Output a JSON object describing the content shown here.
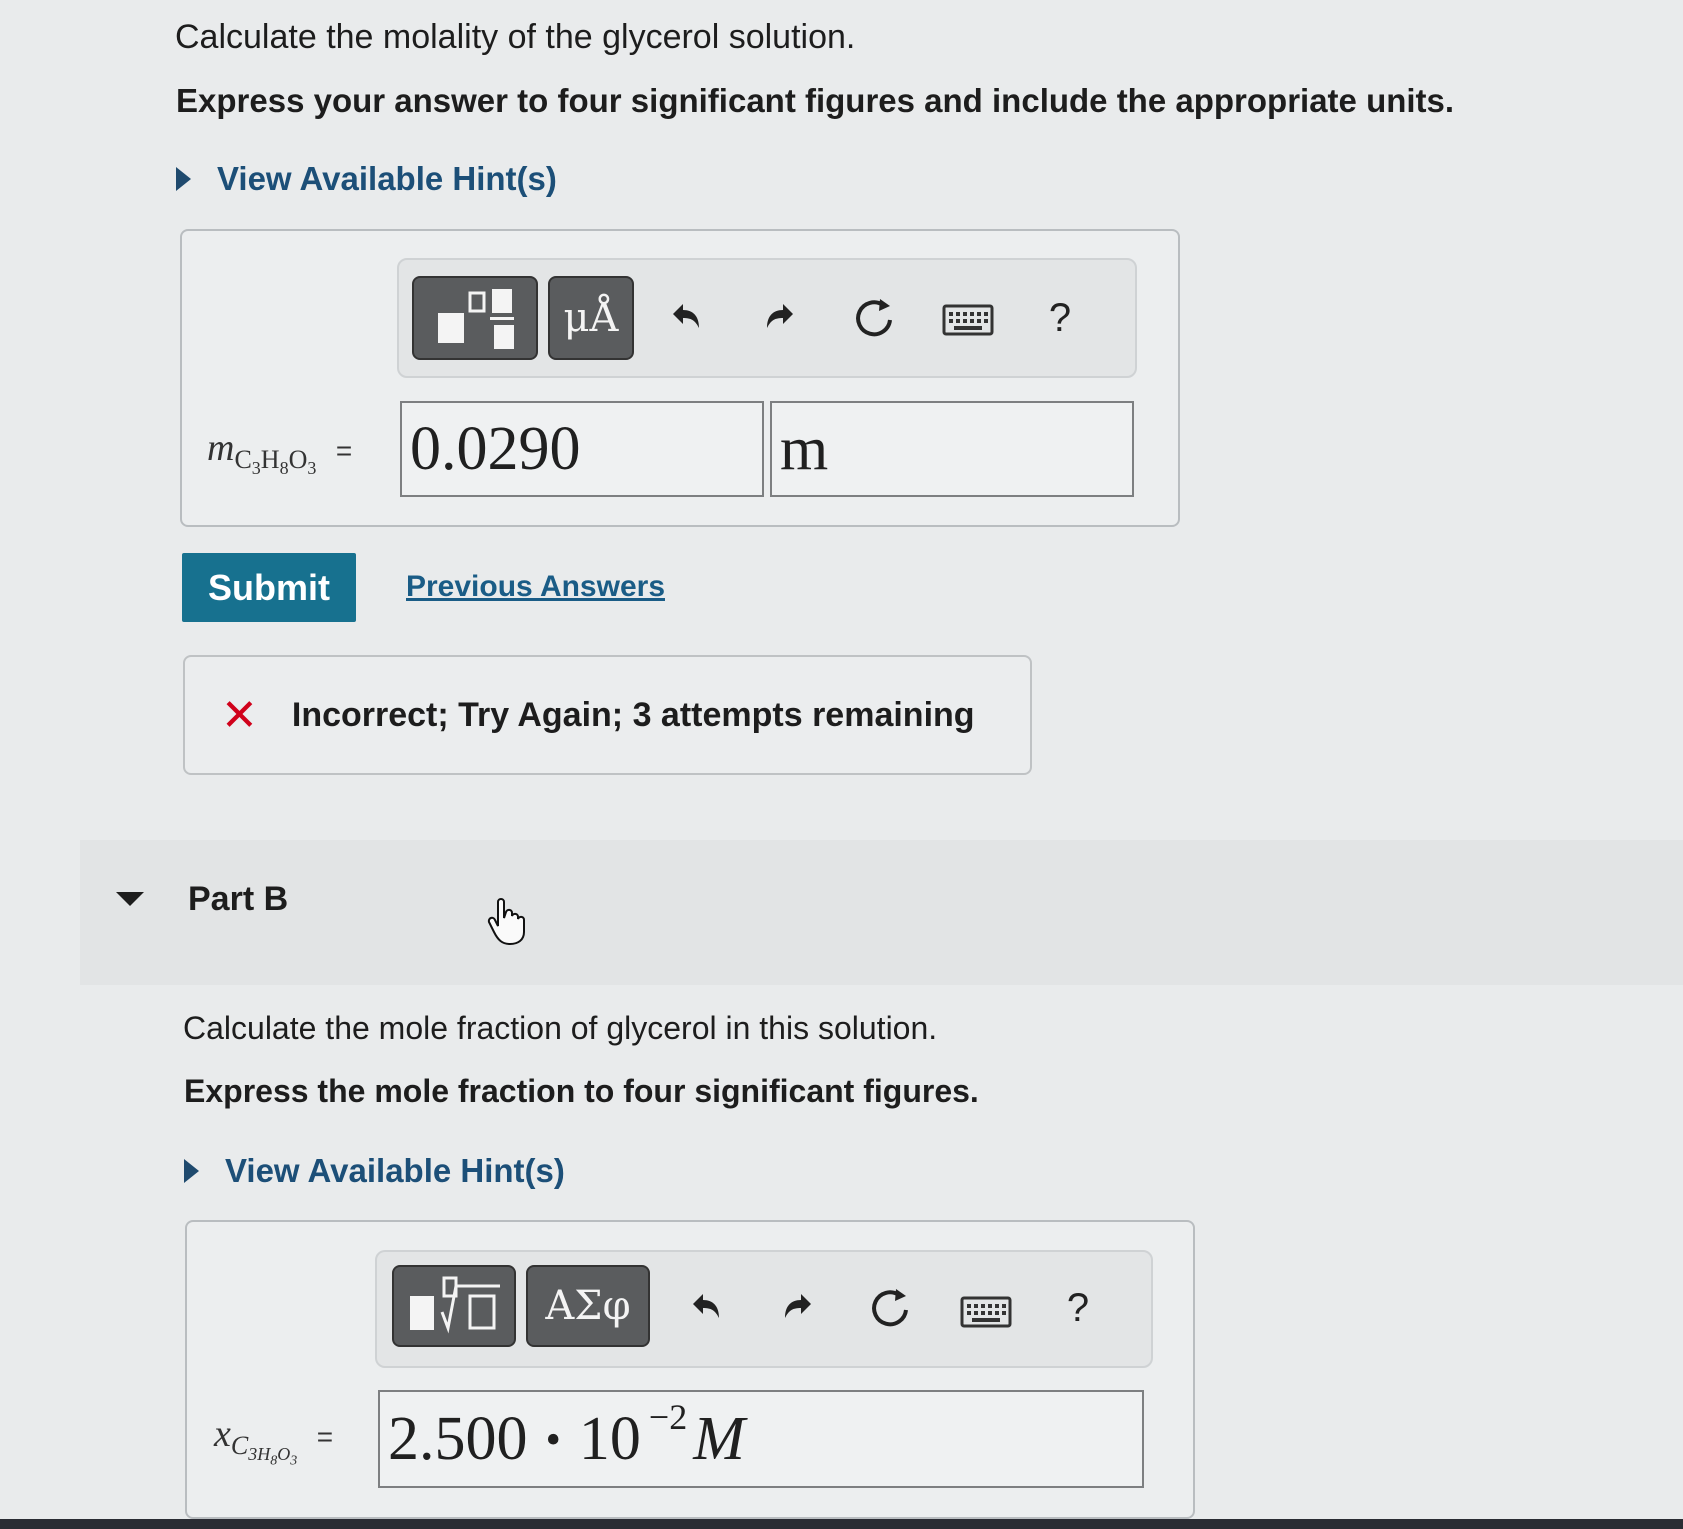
{
  "partA": {
    "question": "Calculate the molality of the glycerol solution.",
    "instruction": "Express your answer to four significant figures and include the appropriate units.",
    "hint_label": "View Available Hint(s)",
    "toolbar": {
      "templates_icon": "templates-icon",
      "units_label": "μÅ",
      "undo_icon": "undo-icon",
      "redo_icon": "redo-icon",
      "reset_icon": "reset-icon",
      "keyboard_icon": "keyboard-icon",
      "help_label": "?"
    },
    "variable": {
      "symbol": "m",
      "subscript_html": "C<sub>3</sub>H<sub>8</sub>O<sub>3</sub>",
      "equals": "="
    },
    "answer_value": "0.0290",
    "answer_unit": "m",
    "submit_label": "Submit",
    "previous_answers_label": "Previous Answers",
    "feedback": {
      "icon": "✕",
      "text": "Incorrect; Try Again; 3 attempts remaining",
      "icon_color": "#d0021b"
    }
  },
  "partB": {
    "title": "Part B",
    "question": "Calculate the mole fraction of glycerol in this solution.",
    "instruction": "Express the mole fraction to four significant figures.",
    "hint_label": "View Available Hint(s)",
    "toolbar": {
      "templates_icon": "templates-icon",
      "greek_label": "ΑΣφ",
      "undo_icon": "undo-icon",
      "redo_icon": "redo-icon",
      "reset_icon": "reset-icon",
      "keyboard_icon": "keyboard-icon",
      "help_label": "?"
    },
    "variable": {
      "symbol": "x",
      "equals": "="
    },
    "answer": {
      "mantissa": "2.500",
      "dot": "•",
      "base": "10",
      "exponent": "−2",
      "unit": "M"
    }
  },
  "colors": {
    "accent": "#17718f",
    "link": "#1a5c86",
    "error": "#d0021b"
  }
}
